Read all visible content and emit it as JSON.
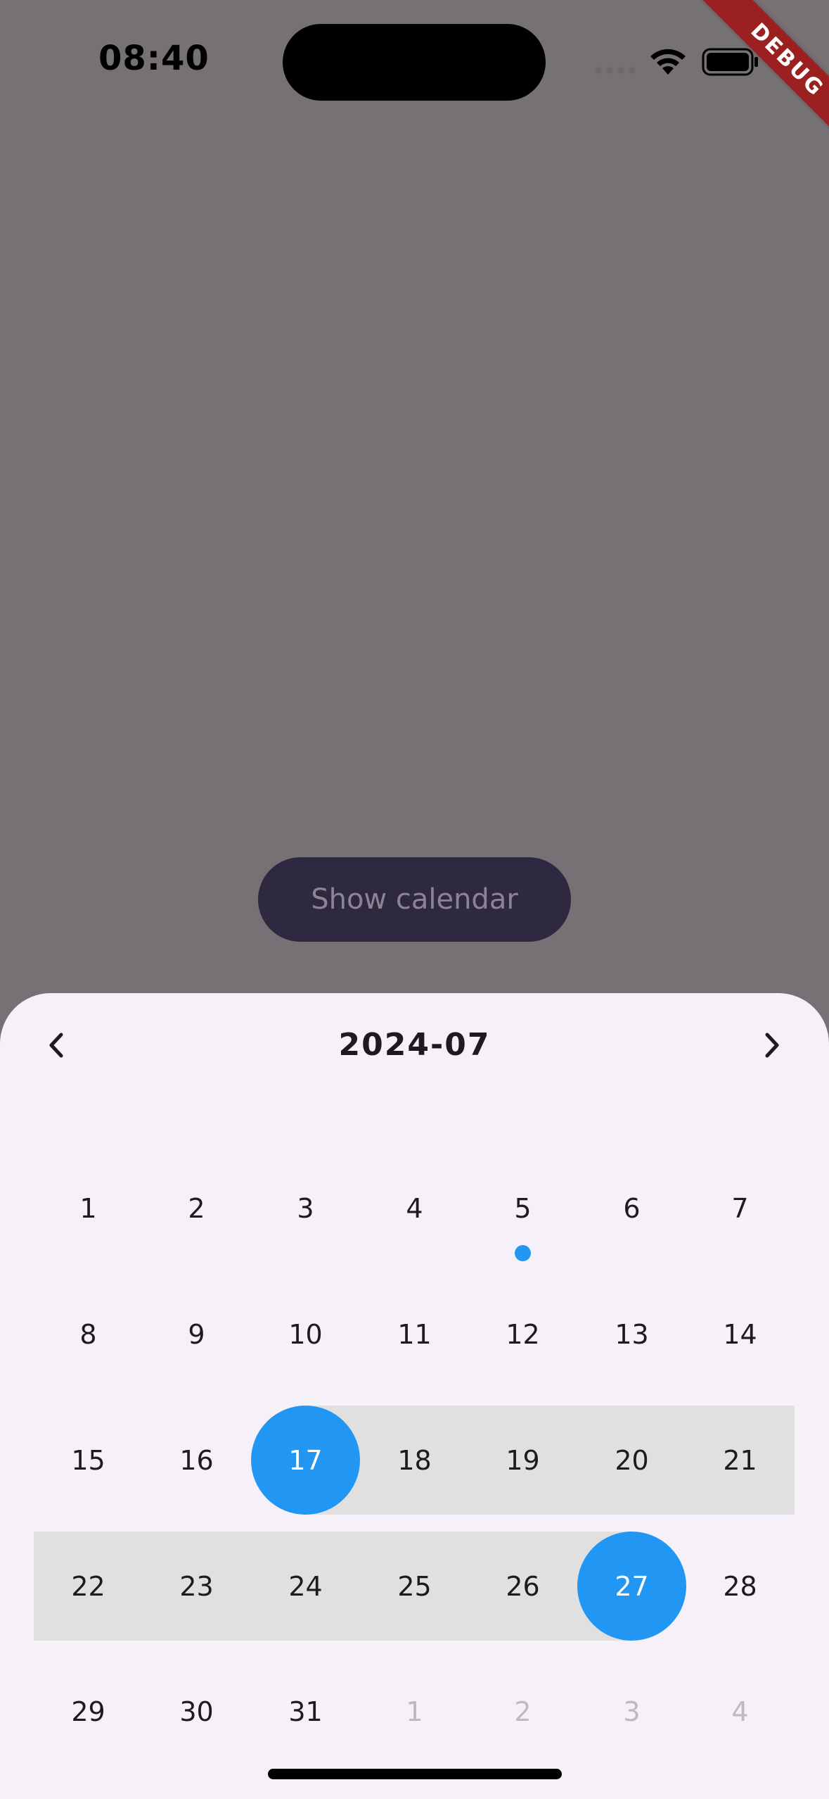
{
  "status_bar": {
    "time": "08:40",
    "icons": [
      "signal-icon",
      "wifi-icon",
      "battery-icon"
    ]
  },
  "debug_banner": {
    "label": "DEBUG",
    "color": "#9b2020"
  },
  "show_calendar_button": {
    "label": "Show calendar"
  },
  "calendar": {
    "title": "2024-07",
    "prev_icon": "chevron-left-icon",
    "next_icon": "chevron-right-icon",
    "accent_color": "#2196f3",
    "range_color": "#e0e0e0",
    "range_start": "17",
    "range_end": "27",
    "weeks": [
      [
        {
          "label": "1"
        },
        {
          "label": "2"
        },
        {
          "label": "3"
        },
        {
          "label": "4"
        },
        {
          "label": "5",
          "event": true
        },
        {
          "label": "6"
        },
        {
          "label": "7"
        }
      ],
      [
        {
          "label": "8"
        },
        {
          "label": "9"
        },
        {
          "label": "10"
        },
        {
          "label": "11"
        },
        {
          "label": "12"
        },
        {
          "label": "13"
        },
        {
          "label": "14"
        }
      ],
      [
        {
          "label": "15"
        },
        {
          "label": "16"
        },
        {
          "label": "17",
          "selected": true
        },
        {
          "label": "18",
          "in_range": true
        },
        {
          "label": "19",
          "in_range": true
        },
        {
          "label": "20",
          "in_range": true
        },
        {
          "label": "21",
          "in_range": true
        }
      ],
      [
        {
          "label": "22",
          "in_range": true
        },
        {
          "label": "23",
          "in_range": true
        },
        {
          "label": "24",
          "in_range": true
        },
        {
          "label": "25",
          "in_range": true
        },
        {
          "label": "26",
          "in_range": true
        },
        {
          "label": "27",
          "selected": true
        },
        {
          "label": "28"
        }
      ],
      [
        {
          "label": "29"
        },
        {
          "label": "30"
        },
        {
          "label": "31"
        },
        {
          "label": "1",
          "outside": true
        },
        {
          "label": "2",
          "outside": true
        },
        {
          "label": "3",
          "outside": true
        },
        {
          "label": "4",
          "outside": true
        }
      ]
    ]
  }
}
